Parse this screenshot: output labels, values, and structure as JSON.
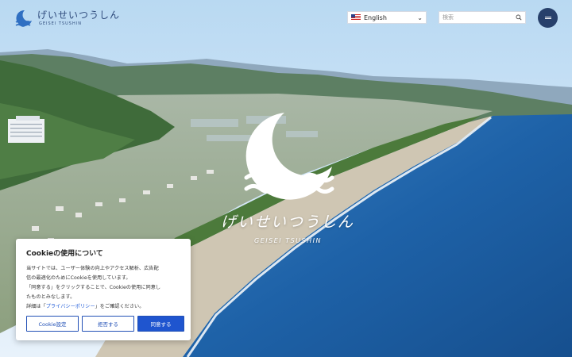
{
  "header": {
    "logo_jp": "げいせいつうしん",
    "logo_en": "GEISEI TSUSHIN",
    "language": {
      "selected": "English",
      "flag_icon": "us-flag-icon"
    },
    "search": {
      "placeholder": "検索",
      "icon": "search-icon"
    },
    "menu_icon": "hamburger-icon"
  },
  "hero": {
    "title_jp": "げいせいつうしん",
    "title_en": "GEISEI TSUSHIN"
  },
  "cookie_banner": {
    "title": "Cookieの使用について",
    "line1": "当サイトでは、ユーザー体験の向上やアクセス解析、広告配",
    "line2": "信の最適化のためにCookieを使用しています。",
    "line3": "「同意する」をクリックすることで、Cookieの使用に同意し",
    "line4": "たものとみなします。",
    "line5_pre": "詳細は「",
    "privacy_link": "プライバシーポリシー",
    "line5_post": "」をご確認ください。",
    "settings_button": "Cookie設定",
    "reject_button": "拒否する",
    "accept_button": "同意する"
  },
  "colors": {
    "brand": "#27406b",
    "accent": "#1f55cf",
    "link": "#1f5bd8"
  }
}
